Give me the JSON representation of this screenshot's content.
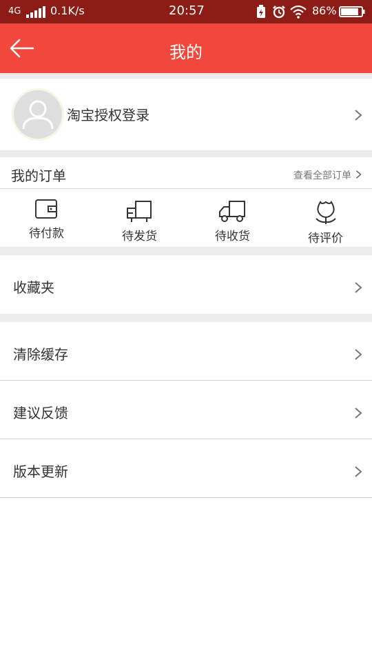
{
  "status_bar": {
    "network": "4G",
    "speed": "0.1K/s",
    "time": "20:57",
    "battery": "86%",
    "battery_level": 0.86,
    "icons": [
      "signal-icon",
      "battery-charging-icon",
      "alarm-icon",
      "wifi-icon",
      "battery-icon"
    ]
  },
  "app_bar": {
    "title": "我的",
    "back_icon": "arrow-left-icon"
  },
  "profile": {
    "login_label": "淘宝授权登录",
    "avatar_icon": "user-placeholder-icon"
  },
  "orders": {
    "title": "我的订单",
    "view_all": "查看全部订单",
    "items": [
      {
        "label": "待付款",
        "icon": "wallet-icon"
      },
      {
        "label": "待发货",
        "icon": "package-icon"
      },
      {
        "label": "待收货",
        "icon": "truck-icon"
      },
      {
        "label": "待评价",
        "icon": "flower-icon"
      }
    ]
  },
  "menu": {
    "favorites": "收藏夹",
    "clear_cache": "清除缓存",
    "feedback": "建议反馈",
    "update": "版本更新"
  },
  "colors": {
    "accent": "#f2473d",
    "status_bar": "#8c1c15",
    "divider": "#ececec"
  }
}
